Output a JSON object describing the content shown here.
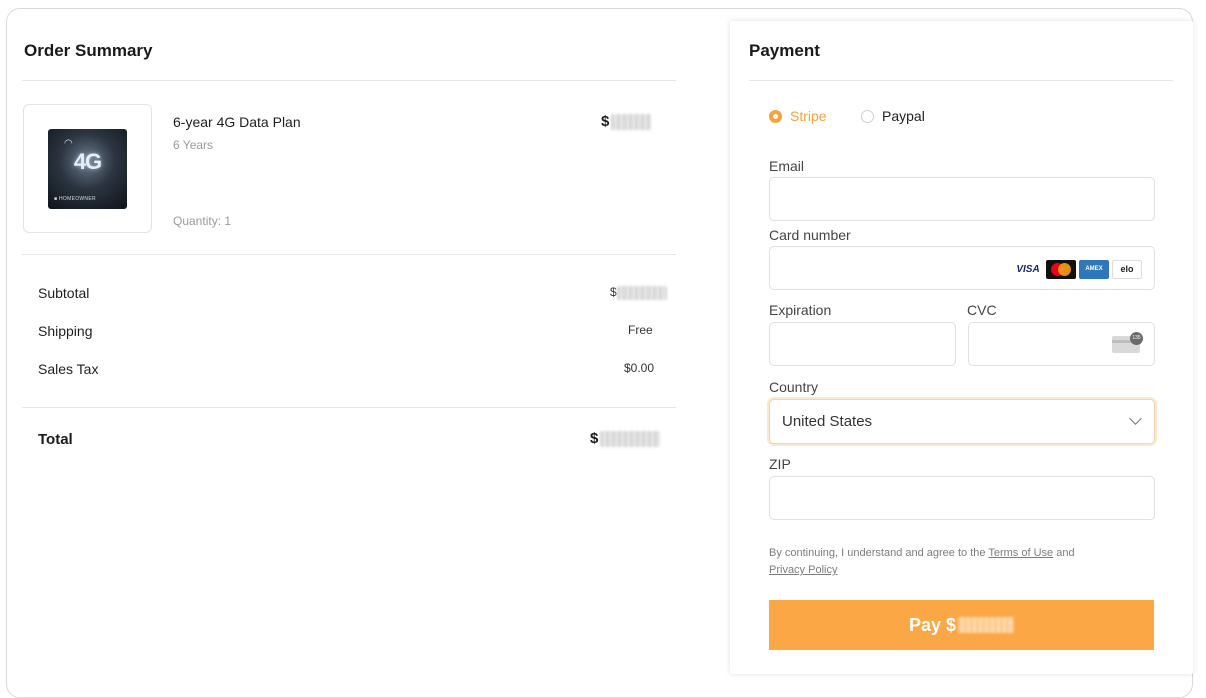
{
  "order_summary": {
    "title": "Order Summary",
    "product": {
      "name": "6-year 4G Data Plan",
      "subtitle": "6 Years",
      "quantity": "Quantity: 1",
      "price_prefix": "$",
      "image_icon": "sim-card-4g-image",
      "image_text": "4G",
      "image_brand": "HOMEOWNER"
    },
    "rows": [
      {
        "label": "Subtotal",
        "value": "$",
        "blurred": true
      },
      {
        "label": "Shipping",
        "value": "Free",
        "blurred": false
      },
      {
        "label": "Sales Tax",
        "value": "$0.00",
        "blurred": false
      }
    ],
    "total": {
      "label": "Total",
      "value_prefix": "$"
    }
  },
  "payment": {
    "title": "Payment",
    "methods": [
      {
        "label": "Stripe",
        "selected": true
      },
      {
        "label": "Paypal",
        "selected": false
      }
    ],
    "fields": {
      "email_label": "Email",
      "card_label": "Card number",
      "expiration_label": "Expiration",
      "cvc_label": "CVC",
      "country_label": "Country",
      "country_value": "United States",
      "zip_label": "ZIP"
    },
    "card_brands": [
      "VISA",
      "mastercard",
      "AMEX",
      "elo"
    ],
    "terms": {
      "prefix": "By continuing, I understand and agree to the ",
      "terms_link": "Terms of Use",
      "middle": " and ",
      "privacy_link": "Privacy Policy"
    },
    "pay_button_prefix": "Pay $",
    "accent_color": "#fba746"
  }
}
